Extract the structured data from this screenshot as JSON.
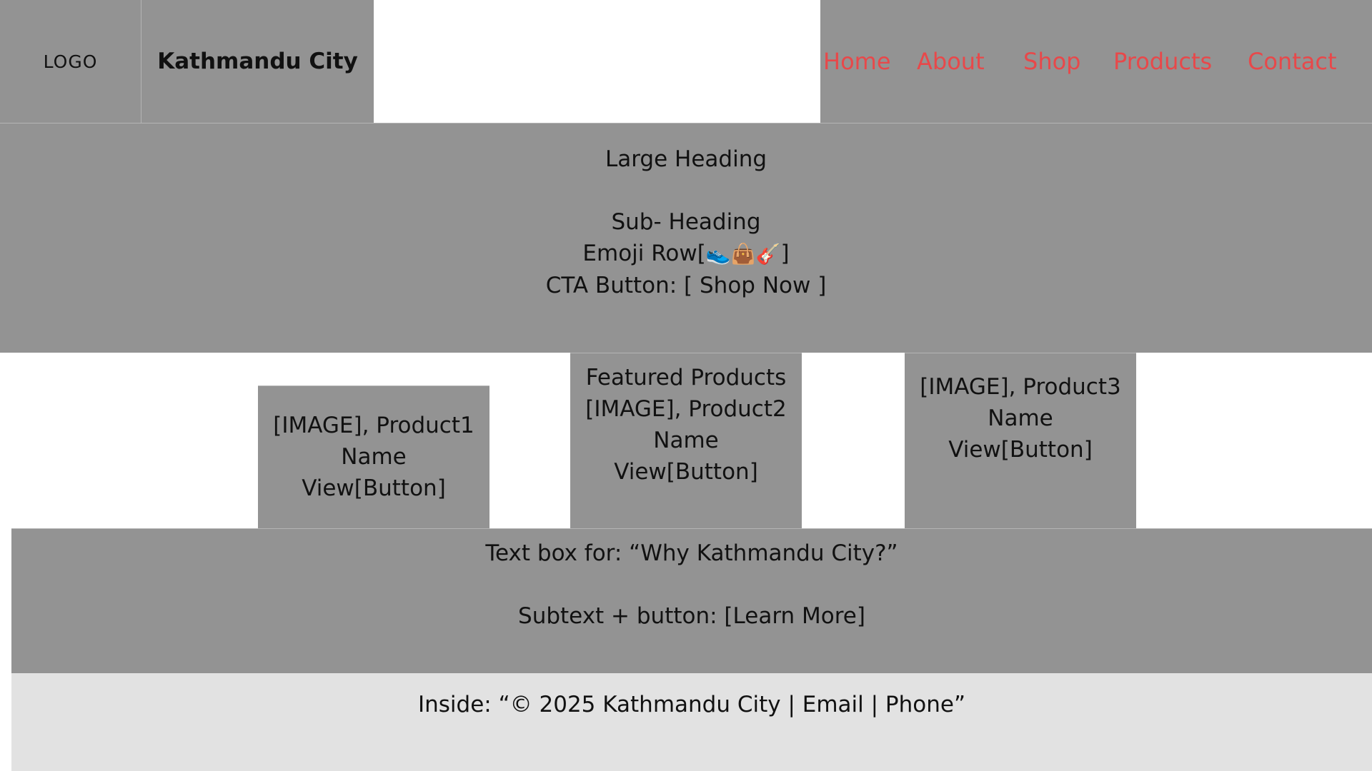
{
  "colors": {
    "panel": "#939393",
    "footer": "#e2e2e2",
    "nav_link": "#e8484a",
    "text": "#111111"
  },
  "header": {
    "logo": "LOGO",
    "brand": "Kathmandu City",
    "nav": [
      "Home",
      "About",
      "Shop",
      "Products",
      "Contact"
    ]
  },
  "hero": {
    "heading": "Large Heading",
    "subheading": "Sub- Heading",
    "emoji_row_prefix": "Emoji Row[",
    "emojis": [
      "👟",
      "👜",
      "🎸"
    ],
    "emoji_row_suffix": "]",
    "cta": "CTA Button: [ Shop Now ]"
  },
  "featured": {
    "title": "Featured Products",
    "products": [
      {
        "line1": "[IMAGE], Product1",
        "line2": "Name",
        "line3": "View[Button]"
      },
      {
        "line1": "[IMAGE], Product2",
        "line2": "Name",
        "line3": "View[Button]"
      },
      {
        "line1": "[IMAGE], Product3",
        "line2": "Name",
        "line3": "View[Button]"
      }
    ]
  },
  "why": {
    "title": "Text box for: “Why Kathmandu City?”",
    "subtext": "Subtext + button: [Learn More]"
  },
  "footer": {
    "text": "Inside: “© 2025 Kathmandu City | Email | Phone”"
  }
}
